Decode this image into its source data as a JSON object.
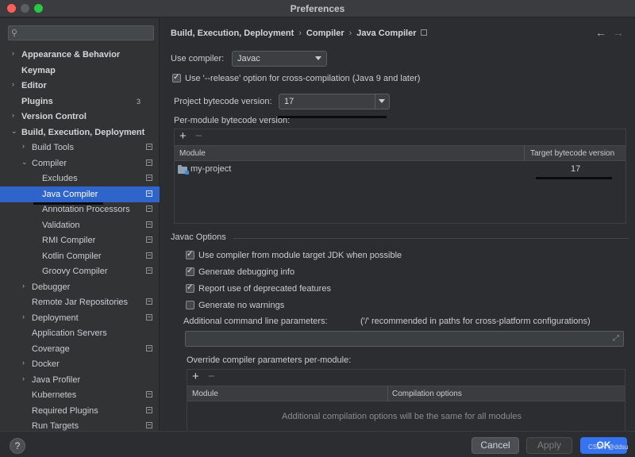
{
  "window": {
    "title": "Preferences"
  },
  "search": {
    "placeholder": ""
  },
  "sidebar": {
    "items": [
      {
        "label": "Appearance & Behavior",
        "chevron": "›"
      },
      {
        "label": "Keymap"
      },
      {
        "label": "Editor",
        "chevron": "›"
      },
      {
        "label": "Plugins",
        "count": "3"
      },
      {
        "label": "Version Control",
        "chevron": "›"
      },
      {
        "label": "Build, Execution, Deployment",
        "chevron": "⌄"
      },
      {
        "label": "Build Tools",
        "chevron": "›"
      },
      {
        "label": "Compiler",
        "chevron": "⌄"
      },
      {
        "label": "Excludes"
      },
      {
        "label": "Java Compiler"
      },
      {
        "label": "Annotation Processors"
      },
      {
        "label": "Validation"
      },
      {
        "label": "RMI Compiler"
      },
      {
        "label": "Kotlin Compiler"
      },
      {
        "label": "Groovy Compiler"
      },
      {
        "label": "Debugger",
        "chevron": "›"
      },
      {
        "label": "Remote Jar Repositories"
      },
      {
        "label": "Deployment",
        "chevron": "›"
      },
      {
        "label": "Application Servers"
      },
      {
        "label": "Coverage"
      },
      {
        "label": "Docker",
        "chevron": "›"
      },
      {
        "label": "Java Profiler",
        "chevron": "›"
      },
      {
        "label": "Kubernetes"
      },
      {
        "label": "Required Plugins"
      },
      {
        "label": "Run Targets"
      }
    ]
  },
  "breadcrumb": {
    "parts": [
      "Build, Execution, Deployment",
      "Compiler",
      "Java Compiler"
    ],
    "sep": "›"
  },
  "nav": {
    "back": "←",
    "forward": "→"
  },
  "compiler": {
    "use_compiler_label": "Use compiler:",
    "use_compiler_value": "Javac",
    "release_option_label": "Use '--release' option for cross-compilation (Java 9 and later)",
    "release_option_checked": true,
    "bytecode_label": "Project bytecode version:",
    "bytecode_value": "17",
    "per_module_label": "Per-module bytecode version:"
  },
  "module_table": {
    "add": "+",
    "remove": "−",
    "columns": [
      "Module",
      "Target bytecode version"
    ],
    "rows": [
      {
        "module": "my-project",
        "version": "17"
      }
    ]
  },
  "javac": {
    "section_title": "Javac Options",
    "options": [
      {
        "label": "Use compiler from module target JDK when possible",
        "checked": true
      },
      {
        "label": "Generate debugging info",
        "checked": true
      },
      {
        "label": "Report use of deprecated features",
        "checked": true
      },
      {
        "label": "Generate no warnings",
        "checked": false
      }
    ],
    "cmd_params_label": "Additional command line parameters:",
    "cmd_params_hint": "('/' recommended in paths for cross-platform configurations)",
    "cmd_params_value": "",
    "override_label": "Override compiler parameters per-module:",
    "override_add": "+",
    "override_remove": "−",
    "override_columns": [
      "Module",
      "Compilation options"
    ],
    "override_empty": "Additional compilation options will be the same for all modules"
  },
  "icons": {
    "check": "✓",
    "search": "⚲",
    "expand": "⤢"
  },
  "footer": {
    "help": "?",
    "cancel": "Cancel",
    "apply": "Apply",
    "ok": "OK",
    "watermark": "CSDN @ddsu"
  },
  "colors": {
    "accent": "#3573f0",
    "selection": "#2f65ca"
  }
}
